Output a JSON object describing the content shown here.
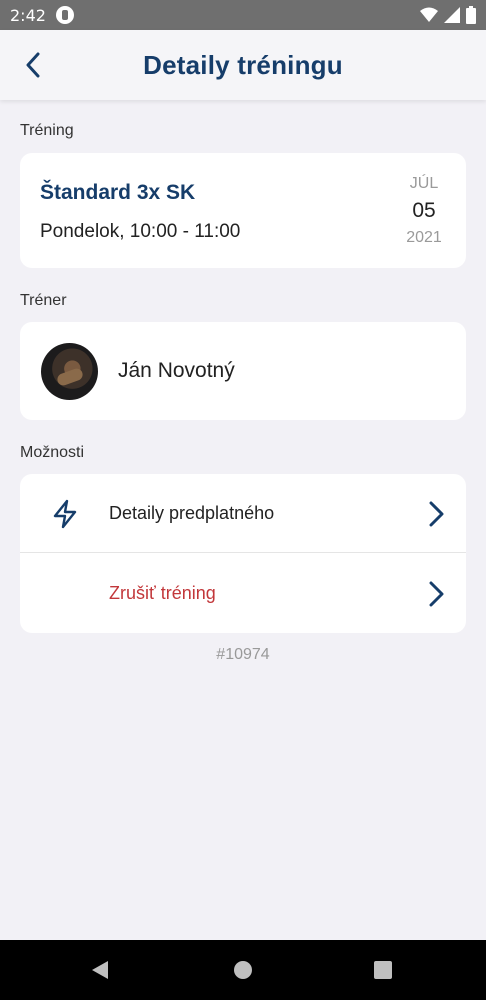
{
  "status_bar": {
    "time": "2:42",
    "icons": [
      "app-notification-icon",
      "wifi-icon",
      "signal-icon",
      "battery-icon"
    ]
  },
  "header": {
    "title": "Detaily tréningu",
    "back_icon": "back-arrow-icon"
  },
  "training": {
    "section_label": "Tréning",
    "name": "Štandard 3x SK",
    "time": "Pondelok, 10:00 - 11:00",
    "date": {
      "month": "JÚL",
      "day": "05",
      "year": "2021"
    }
  },
  "trainer": {
    "section_label": "Tréner",
    "name": "Ján Novotný"
  },
  "options": {
    "section_label": "Možnosti",
    "items": [
      {
        "label": "Detaily predplatného",
        "icon": "lightning-icon"
      },
      {
        "label": "Zrušiť tréning",
        "icon": ""
      }
    ]
  },
  "booking_id": "#10974",
  "colors": {
    "primary": "#163d6a",
    "danger": "#c2373a",
    "background": "#f2f1f6",
    "card": "#ffffff"
  }
}
